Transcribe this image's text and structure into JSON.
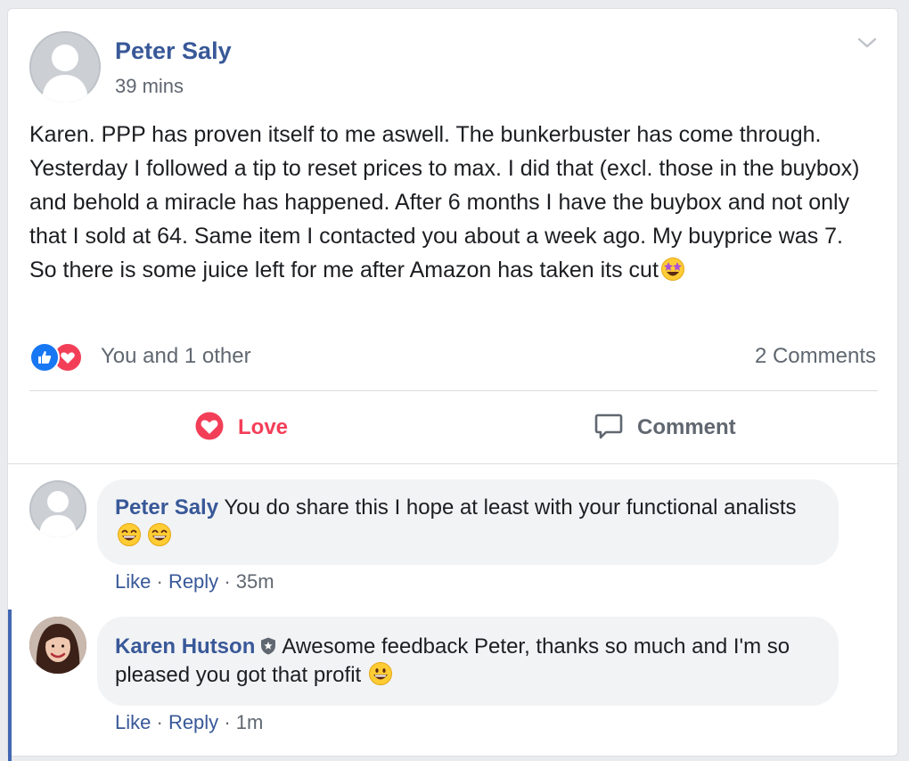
{
  "post": {
    "author": "Peter Saly",
    "time": "39 mins",
    "text": "Karen. PPP has proven itself to me aswell. The bunkerbuster has come through. Yesterday I followed a tip to reset prices to max. I did that (excl. those in the buybox) and behold a miracle has happened. After 6 months I have the buybox and not only that I sold at 64. Same item I contacted you about a week ago. My buyprice was 7. So there is some juice left for me after Amazon has taken its cut",
    "reactions_text": "You and 1 other",
    "comments_count": "2 Comments"
  },
  "actions": {
    "love_label": "Love",
    "comment_label": "Comment"
  },
  "comments": [
    {
      "author": "Peter Saly",
      "text": "You do share this I hope at least with your functional analists",
      "like_label": "Like",
      "reply_label": "Reply",
      "time": "35m"
    },
    {
      "author": "Karen Hutson",
      "text": "Awesome feedback Peter, thanks so much and I'm so pleased you got that profit",
      "like_label": "Like",
      "reply_label": "Reply",
      "time": "1m"
    }
  ],
  "icons": {
    "options": "chevron-down-icon",
    "like_reaction": "thumbs-up-icon",
    "love_reaction": "heart-icon",
    "love_action": "heart-icon",
    "comment_action": "speech-bubble-icon",
    "moderator_badge": "shield-star-icon",
    "emoji_star_struck": "star-struck-emoji-icon",
    "emoji_grin": "grinning-squinting-emoji-icon",
    "emoji_smile": "grinning-emoji-icon"
  },
  "colors": {
    "link": "#385898",
    "love": "#f33e58",
    "like": "#1877f2",
    "muted": "#606770",
    "bubble": "#f2f3f5",
    "highlight": "#4267b2"
  }
}
